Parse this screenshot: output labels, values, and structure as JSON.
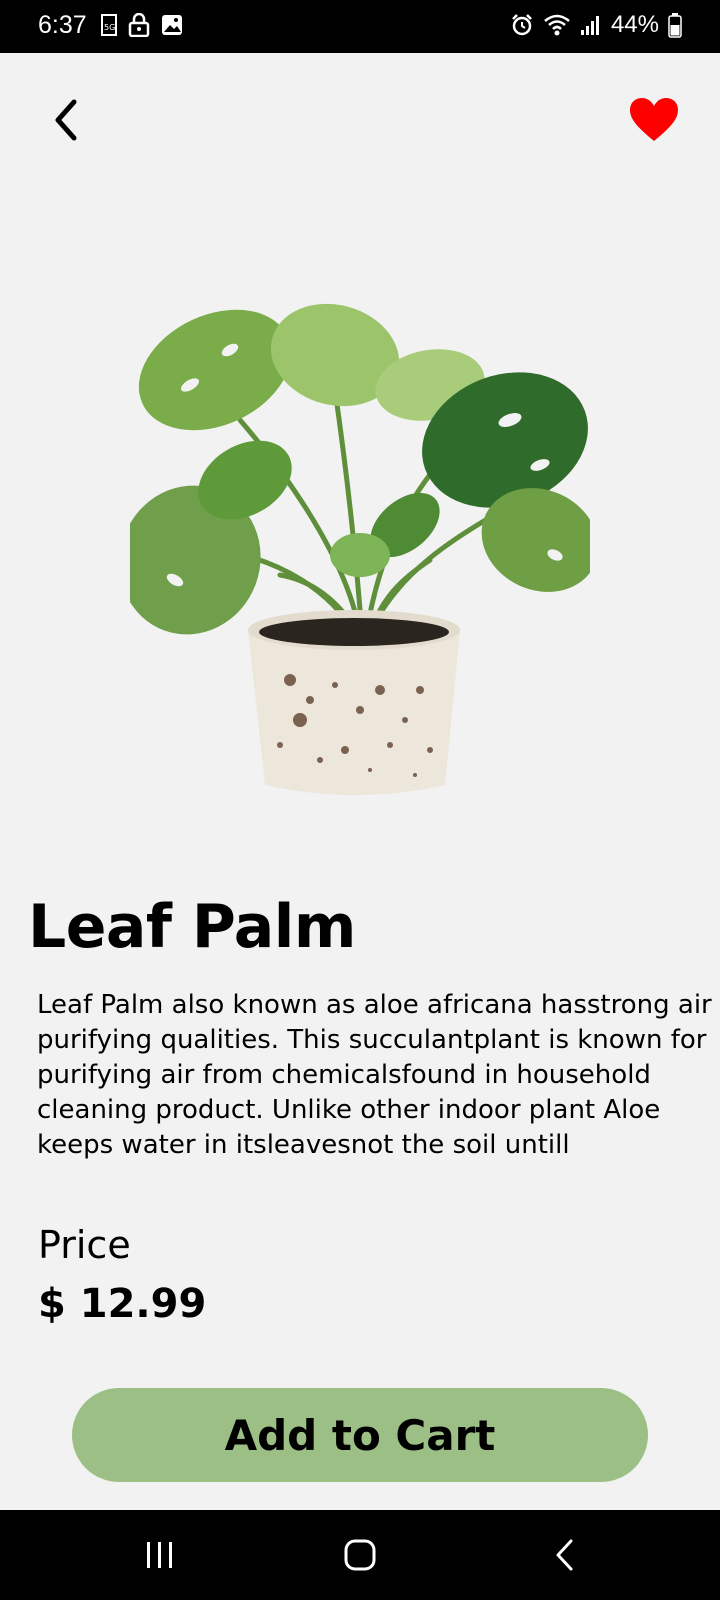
{
  "status_bar": {
    "time": "6:37",
    "battery": "44%",
    "icons": [
      "sim-icon",
      "lock-icon",
      "image-icon",
      "alarm-icon",
      "wifi-icon",
      "signal-icon",
      "battery-icon"
    ]
  },
  "header": {
    "back_icon": "back-arrow-icon",
    "favorite_icon": "heart-icon",
    "favorite_color": "#ff0000"
  },
  "product": {
    "title": "Leaf Palm",
    "description": "Leaf Palm also known as aloe africana hasstrong air purifying qualities. This succulantplant is known for purifying air from chemicalsfound in household cleaning product. Unlike other indoor plant Aloe keeps water in itsleavesnot the soil untill",
    "price_label": "Price",
    "price": "$ 12.99"
  },
  "actions": {
    "add_to_cart_label": "Add to Cart",
    "button_color": "#9bbf85"
  },
  "nav_bar": {
    "icons": [
      "recent-apps-icon",
      "home-icon",
      "back-icon"
    ]
  }
}
